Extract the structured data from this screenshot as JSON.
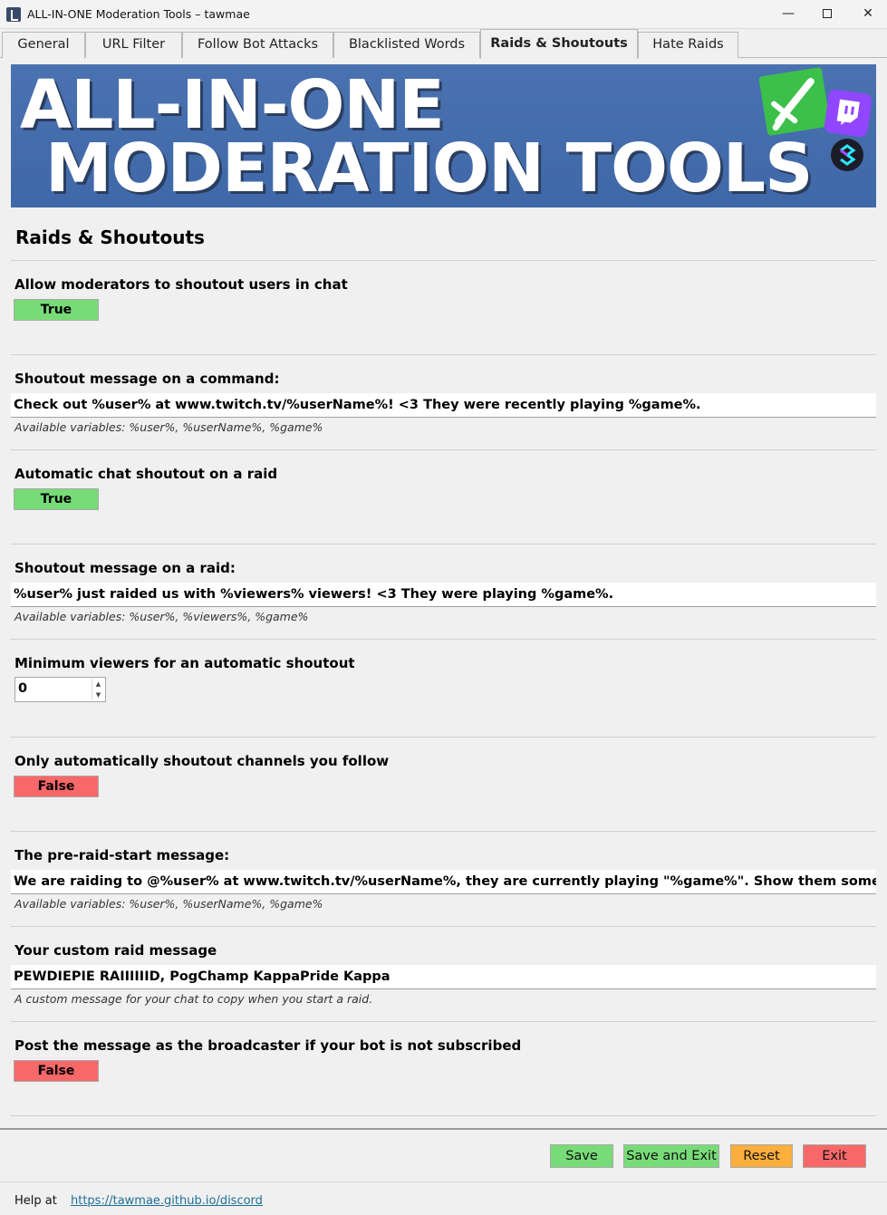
{
  "window": {
    "title": "ALL-IN-ONE Moderation Tools – tawmae",
    "minimize": "—",
    "close": "✕"
  },
  "tabs": [
    {
      "label": "General"
    },
    {
      "label": "URL Filter"
    },
    {
      "label": "Follow Bot Attacks"
    },
    {
      "label": "Blacklisted Words"
    },
    {
      "label": "Raids & Shoutouts",
      "active": true
    },
    {
      "label": "Hate Raids"
    }
  ],
  "banner": {
    "line1": "ALL-IN-ONE",
    "line2": "MODERATION TOOLS",
    "icons": [
      "sword-icon",
      "twitch-icon",
      "streamer-bot-icon"
    ]
  },
  "section": {
    "title": "Raids & Shoutouts"
  },
  "settings": {
    "mod_shoutout": {
      "label": "Allow moderators to shoutout users in chat",
      "value": "True"
    },
    "command_message": {
      "label": "Shoutout message on a command:",
      "value": "Check out %user% at www.twitch.tv/%userName%! <3 They were recently playing %game%.",
      "hint": "Available variables: %user%, %userName%, %game%"
    },
    "auto_shoutout": {
      "label": "Automatic chat shoutout on a raid",
      "value": "True"
    },
    "raid_message": {
      "label": "Shoutout message on a raid:",
      "value": "%user% just raided us with %viewers% viewers! <3 They were playing %game%.",
      "hint": "Available variables: %user%, %viewers%, %game%"
    },
    "min_viewers": {
      "label": "Minimum viewers for an automatic shoutout",
      "value": "0"
    },
    "only_followed": {
      "label": "Only automatically shoutout channels you follow",
      "value": "False"
    },
    "pre_raid": {
      "label": "The pre-raid-start message:",
      "value": "We are raiding to @%user% at www.twitch.tv/%userName%, they are currently playing \"%game%\". Show them some love wi",
      "hint": "Available variables: %user%, %userName%, %game%"
    },
    "custom_raid": {
      "label": "Your custom raid message",
      "value": "PEWDIEPIE RAIIIIIID, PogChamp KappaPride Kappa",
      "hint": "A custom message for your chat to copy when you start a raid."
    },
    "post_broadcaster": {
      "label": "Post the message as the broadcaster if your bot is not subscribed",
      "value": "False"
    }
  },
  "buttons": {
    "save": "Save",
    "save_exit": "Save and Exit",
    "reset": "Reset",
    "exit": "Exit"
  },
  "footer": {
    "help_label": "Help at",
    "help_link": "https://tawmae.github.io/discord"
  },
  "colors": {
    "true_green": "#77dc77",
    "false_red": "#f96868",
    "reset_orange": "#fdae3c",
    "banner_blue": "#4a72b0",
    "link_blue": "#1f6f95"
  }
}
